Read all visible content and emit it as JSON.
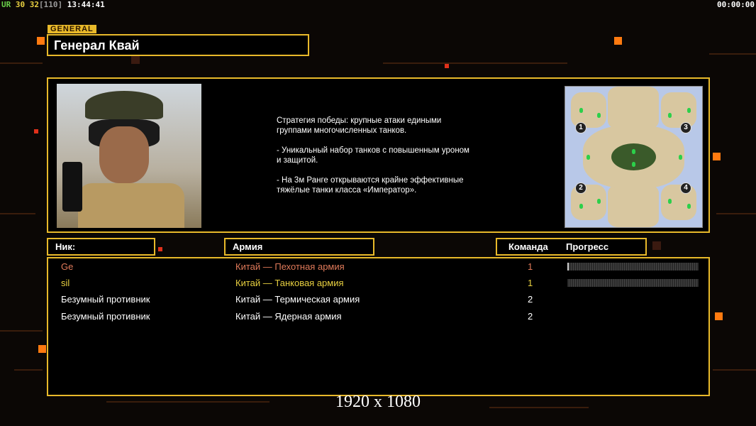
{
  "hud": {
    "ur": "UR",
    "n1": "30",
    "n2": "32",
    "bracket": "[110]",
    "time": "13:44:41",
    "timer": "00:00:00"
  },
  "general": {
    "tag": "GENERAL",
    "title": "Генерал Квай",
    "strategy": "Стратегия победы: крупные атаки едиными\n группами многочисленных танков.\n\n- Уникальный набор танков с повышенным уроном\n  и защитой.\n\n- На 3м Ранге открываются крайне эффективные\n  тяжёлые танки класса «Император»."
  },
  "map": {
    "spawns": [
      "1",
      "2",
      "3",
      "4"
    ]
  },
  "table": {
    "headers": {
      "nick": "Ник:",
      "army": "Армия",
      "team": "Команда",
      "progress": "Прогресс"
    },
    "rows": [
      {
        "nick": "Ge",
        "army": "Китай — Пехотная армия",
        "team": "1",
        "color": "#e07a5a",
        "progress": 0.01
      },
      {
        "nick": "sil",
        "army": "Китай — Танковая армия",
        "team": "1",
        "color": "#e8d040",
        "progress": 0.0
      },
      {
        "nick": "Безумный противник",
        "army": "Китай — Термическая армия",
        "team": "2",
        "color": "#ffffff"
      },
      {
        "nick": "Безумный противник",
        "army": "Китай — Ядерная армия",
        "team": "2",
        "color": "#ffffff"
      }
    ]
  },
  "resolution": "1920 x 1080",
  "colors": {
    "accent": "#e8b92a",
    "hud_green": "#6ad04a",
    "hud_yellow": "#e8d040",
    "hud_gray": "#9a9a9a"
  }
}
